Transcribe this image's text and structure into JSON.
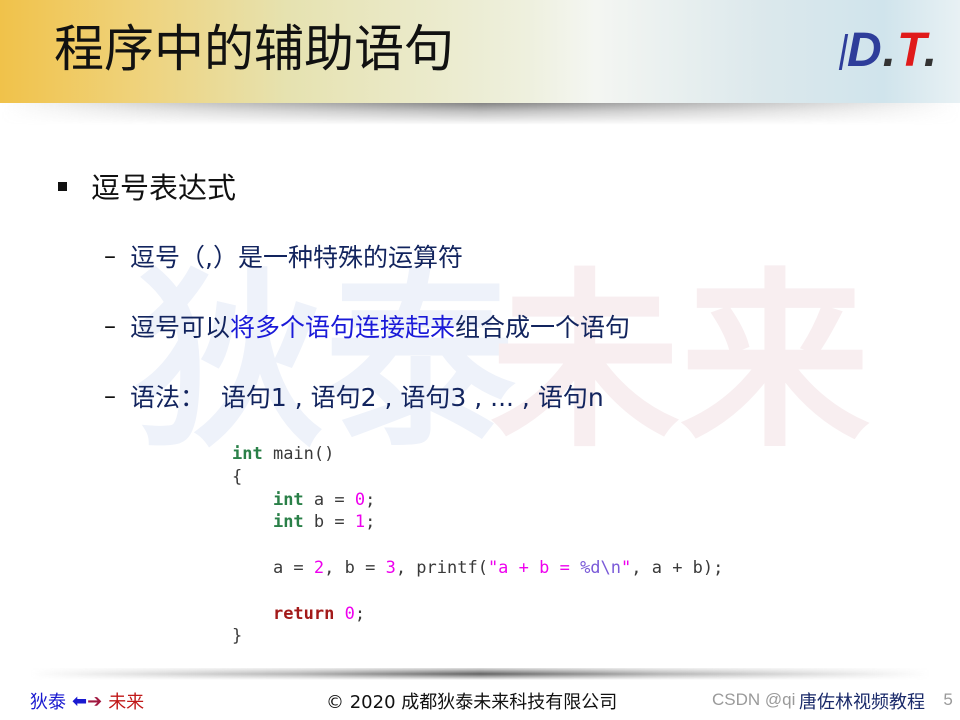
{
  "header": {
    "title": "程序中的辅助语句",
    "logo": {
      "d": "D",
      "dot1": ".",
      "t": "T",
      "dot2": "."
    }
  },
  "watermark": {
    "left": "狄泰",
    "right": "未来"
  },
  "content": {
    "bullet": "逗号表达式",
    "sub_items": [
      {
        "text": "逗号（,）是一种特殊的运算符"
      },
      {
        "pre": "逗号可以",
        "highlight": "将多个语句连接起来",
        "post": "组合成一个语句"
      },
      {
        "text": "语法：  语句1 , 语句2 , 语句3 , ... , 语句n"
      }
    ],
    "dash": "–"
  },
  "code": {
    "lines": [
      [
        {
          "t": "int",
          "c": "kw"
        },
        {
          "t": " main()",
          "c": ""
        }
      ],
      [
        {
          "t": "{",
          "c": ""
        }
      ],
      [
        {
          "t": "    ",
          "c": ""
        },
        {
          "t": "int",
          "c": "kw"
        },
        {
          "t": " a = ",
          "c": ""
        },
        {
          "t": "0",
          "c": "num"
        },
        {
          "t": ";",
          "c": ""
        }
      ],
      [
        {
          "t": "    ",
          "c": ""
        },
        {
          "t": "int",
          "c": "kw"
        },
        {
          "t": " b = ",
          "c": ""
        },
        {
          "t": "1",
          "c": "num"
        },
        {
          "t": ";",
          "c": ""
        }
      ],
      [
        {
          "t": "",
          "c": ""
        }
      ],
      [
        {
          "t": "    a = ",
          "c": ""
        },
        {
          "t": "2",
          "c": "num"
        },
        {
          "t": ", b = ",
          "c": ""
        },
        {
          "t": "3",
          "c": "num"
        },
        {
          "t": ", printf(",
          "c": ""
        },
        {
          "t": "\"a + b = ",
          "c": "str"
        },
        {
          "t": "%d\\n",
          "c": "fmt"
        },
        {
          "t": "\"",
          "c": "str"
        },
        {
          "t": ", a + b);",
          "c": ""
        }
      ],
      [
        {
          "t": "",
          "c": ""
        }
      ],
      [
        {
          "t": "    ",
          "c": ""
        },
        {
          "t": "return",
          "c": "kw2"
        },
        {
          "t": " ",
          "c": ""
        },
        {
          "t": "0",
          "c": "num"
        },
        {
          "t": ";",
          "c": ""
        }
      ],
      [
        {
          "t": "}",
          "c": ""
        }
      ]
    ]
  },
  "footer": {
    "left_blue": "狄泰",
    "arrow_left": "🡄",
    "arrow_right": "🡆",
    "left_red": "未来",
    "center": "© 2020 成都狄泰未来科技有限公司",
    "csdn": "CSDN @qi",
    "csdn_tail": "5",
    "overlay": "唐佐林视频教程"
  }
}
